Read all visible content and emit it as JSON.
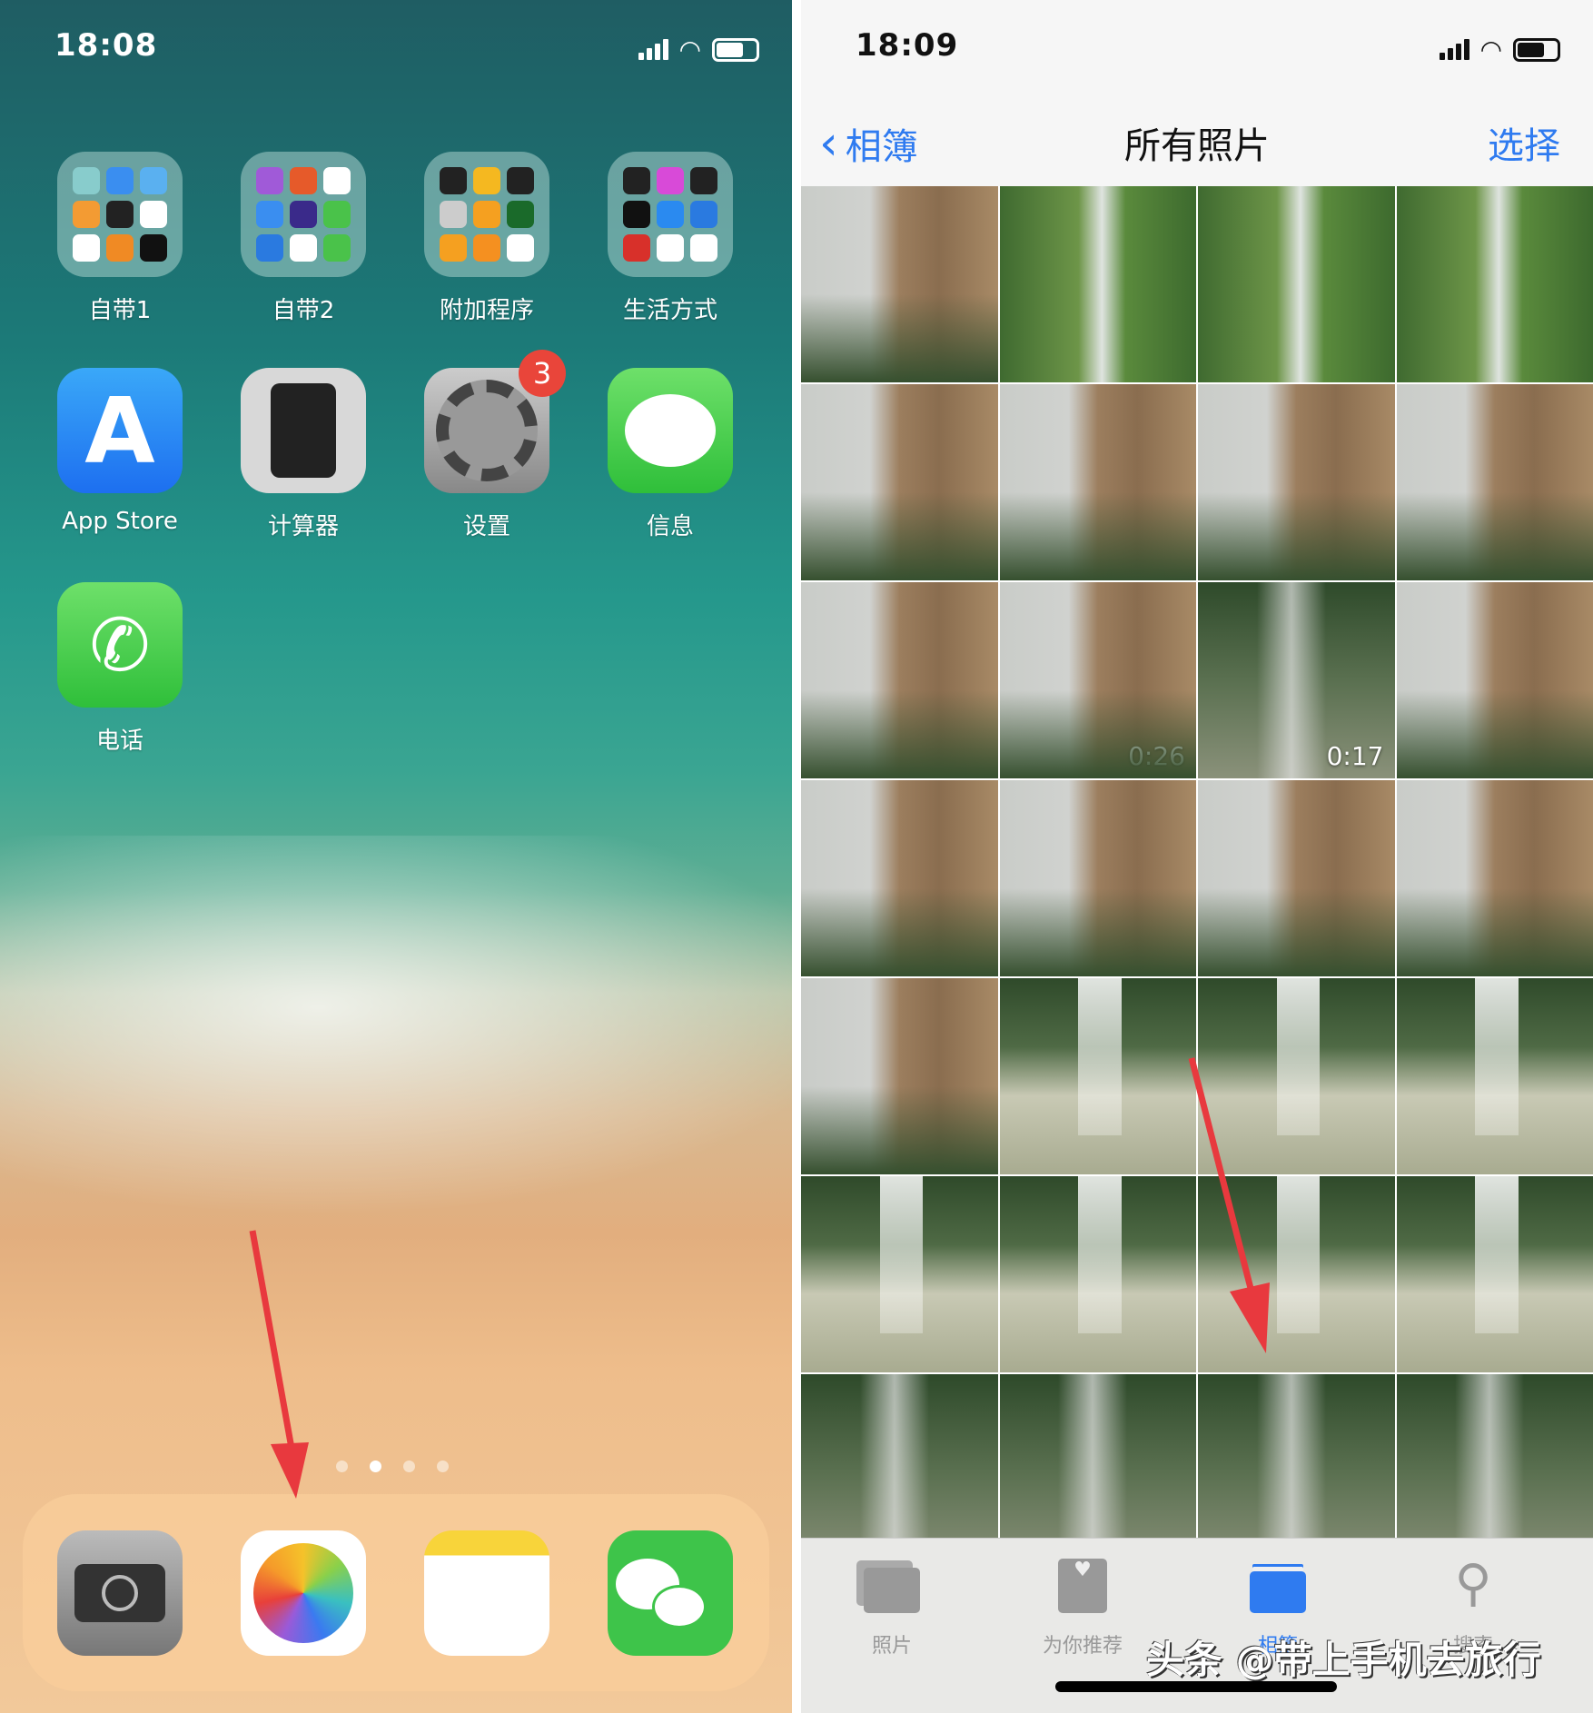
{
  "left_screen": {
    "status": {
      "time": "18:08"
    },
    "folders": [
      {
        "label": "自带1"
      },
      {
        "label": "自带2"
      },
      {
        "label": "附加程序"
      },
      {
        "label": "生活方式"
      }
    ],
    "apps": [
      {
        "label": "App Store",
        "icon": "app-store-icon"
      },
      {
        "label": "计算器",
        "icon": "calculator-icon"
      },
      {
        "label": "设置",
        "icon": "settings-gear-icon",
        "badge": "3"
      },
      {
        "label": "信息",
        "icon": "messages-icon"
      },
      {
        "label": "电话",
        "icon": "phone-icon"
      }
    ],
    "page_dots": {
      "count": 4,
      "active": 2
    },
    "dock": [
      {
        "icon": "camera-icon"
      },
      {
        "icon": "photos-icon"
      },
      {
        "icon": "notes-icon"
      },
      {
        "icon": "wechat-icon"
      }
    ]
  },
  "right_screen": {
    "status": {
      "time": "18:09"
    },
    "nav": {
      "back_label": "相簿",
      "title": "所有照片",
      "select_label": "选择"
    },
    "video_durations": [
      "0:26",
      "0:17"
    ],
    "tabs": [
      {
        "label": "照片",
        "active": false
      },
      {
        "label": "为你推荐",
        "active": false
      },
      {
        "label": "相簿",
        "active": true
      },
      {
        "label": "搜索",
        "active": false
      }
    ],
    "watermark": "头条 @带上手机去旅行"
  },
  "colors": {
    "accent": "#2f7bf0",
    "badge": "#e9453a",
    "arrow": "#e8393e"
  }
}
